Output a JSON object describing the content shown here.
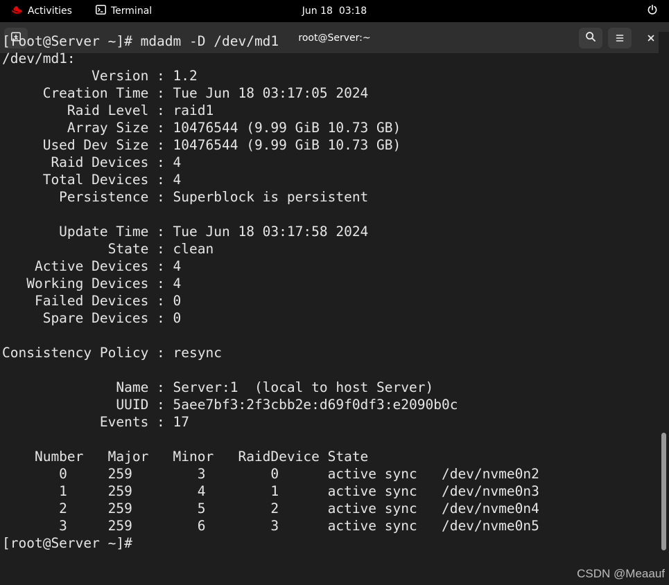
{
  "topbar": {
    "activities_label": "Activities",
    "activities_icon": "redhat-logo-icon",
    "app_label": "Terminal",
    "app_icon": "terminal-icon",
    "clock": "Jun 18  03:18",
    "power_icon": "power-icon"
  },
  "window": {
    "title": "root@Server:~",
    "new_tab_icon": "new-tab-icon",
    "search_icon": "search-icon",
    "menu_icon": "hamburger-menu-icon",
    "close_icon": "close-icon"
  },
  "terminal": {
    "lines": [
      "[root@Server ~]# mdadm -D /dev/md1",
      "/dev/md1:",
      "           Version : 1.2",
      "     Creation Time : Tue Jun 18 03:17:05 2024",
      "        Raid Level : raid1",
      "        Array Size : 10476544 (9.99 GiB 10.73 GB)",
      "     Used Dev Size : 10476544 (9.99 GiB 10.73 GB)",
      "      Raid Devices : 4",
      "     Total Devices : 4",
      "       Persistence : Superblock is persistent",
      "",
      "       Update Time : Tue Jun 18 03:17:58 2024",
      "             State : clean",
      "    Active Devices : 4",
      "   Working Devices : 4",
      "    Failed Devices : 0",
      "     Spare Devices : 0",
      "",
      "Consistency Policy : resync",
      "",
      "              Name : Server:1  (local to host Server)",
      "              UUID : 5aee7bf3:2f3cbb2e:d69f0df3:e2090b0c",
      "            Events : 17",
      "",
      "    Number   Major   Minor   RaidDevice State",
      "       0     259        3        0      active sync   /dev/nvme0n2",
      "       1     259        4        1      active sync   /dev/nvme0n3",
      "       2     259        5        2      active sync   /dev/nvme0n4",
      "       3     259        6        3      active sync   /dev/nvme0n5",
      "[root@Server ~]# "
    ]
  },
  "watermark": "CSDN @Meaauf",
  "colors": {
    "terminal_bg": "#1e1e1e",
    "terminal_fg": "#e6e6e6",
    "headerbar_bg": "#2f2f2f",
    "topbar_bg": "#000000",
    "redhat_red": "#ee0000"
  }
}
